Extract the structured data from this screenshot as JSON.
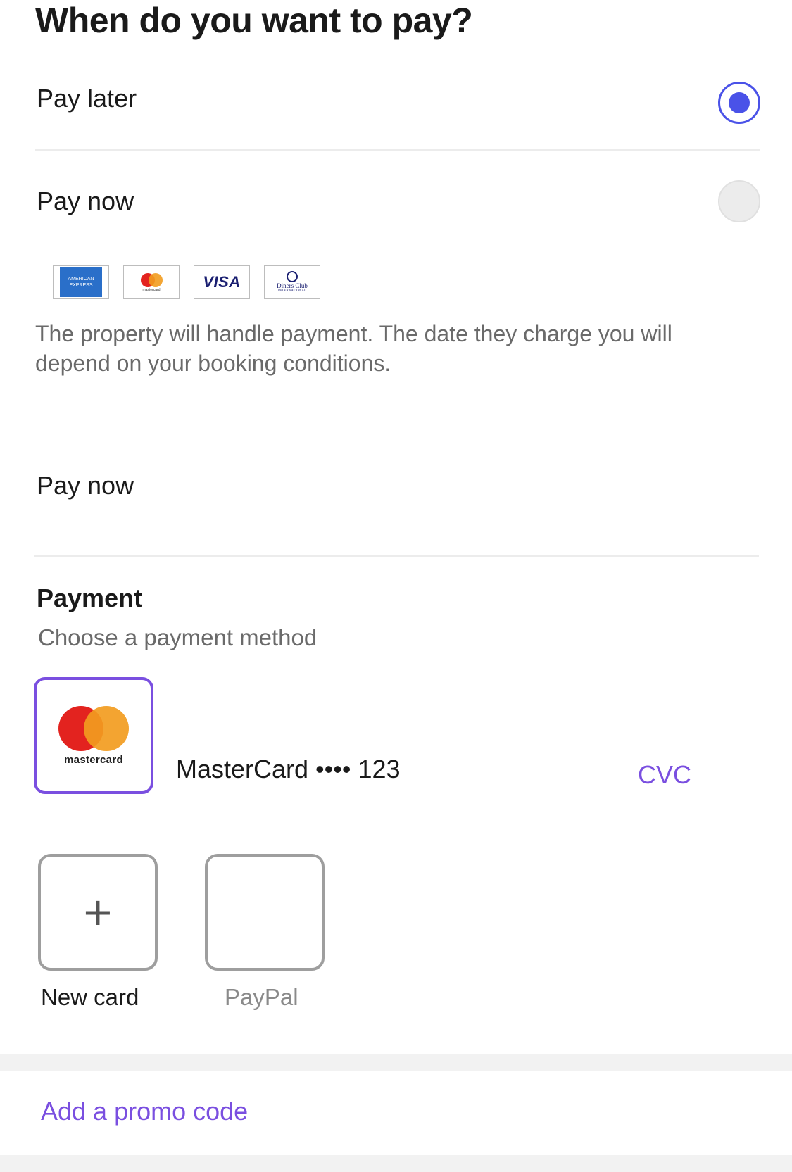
{
  "page": {
    "title": "When do you want to pay?"
  },
  "pay_options": [
    {
      "label": "Pay later",
      "selected": true
    },
    {
      "label": "Pay now",
      "selected": false
    }
  ],
  "card_logos": {
    "amex": "AMERICAN EXPRESS",
    "mastercard": "mastercard",
    "visa": "VISA",
    "diners": "Diners Club",
    "diners_sub": "INTERNATIONAL"
  },
  "pay_later_description": "The property will handle payment. The date they charge you will depend on your booking conditions.",
  "pay_now_section": {
    "label": "Pay now"
  },
  "payment": {
    "title": "Payment",
    "subtitle": "Choose a payment method",
    "saved_card": {
      "brand_word": "mastercard",
      "label": "MasterCard •••• 123",
      "cvc_label": "CVC"
    },
    "methods": [
      {
        "label": "New card",
        "icon": "plus-icon"
      },
      {
        "label": "PayPal",
        "icon": "paypal-icon"
      }
    ]
  },
  "promo": {
    "label": "Add a promo code"
  },
  "colors": {
    "accent": "#7a4fe0",
    "radio_selected": "#4a52e8",
    "mastercard_red": "#e3231f",
    "mastercard_orange": "#f29c1f"
  }
}
